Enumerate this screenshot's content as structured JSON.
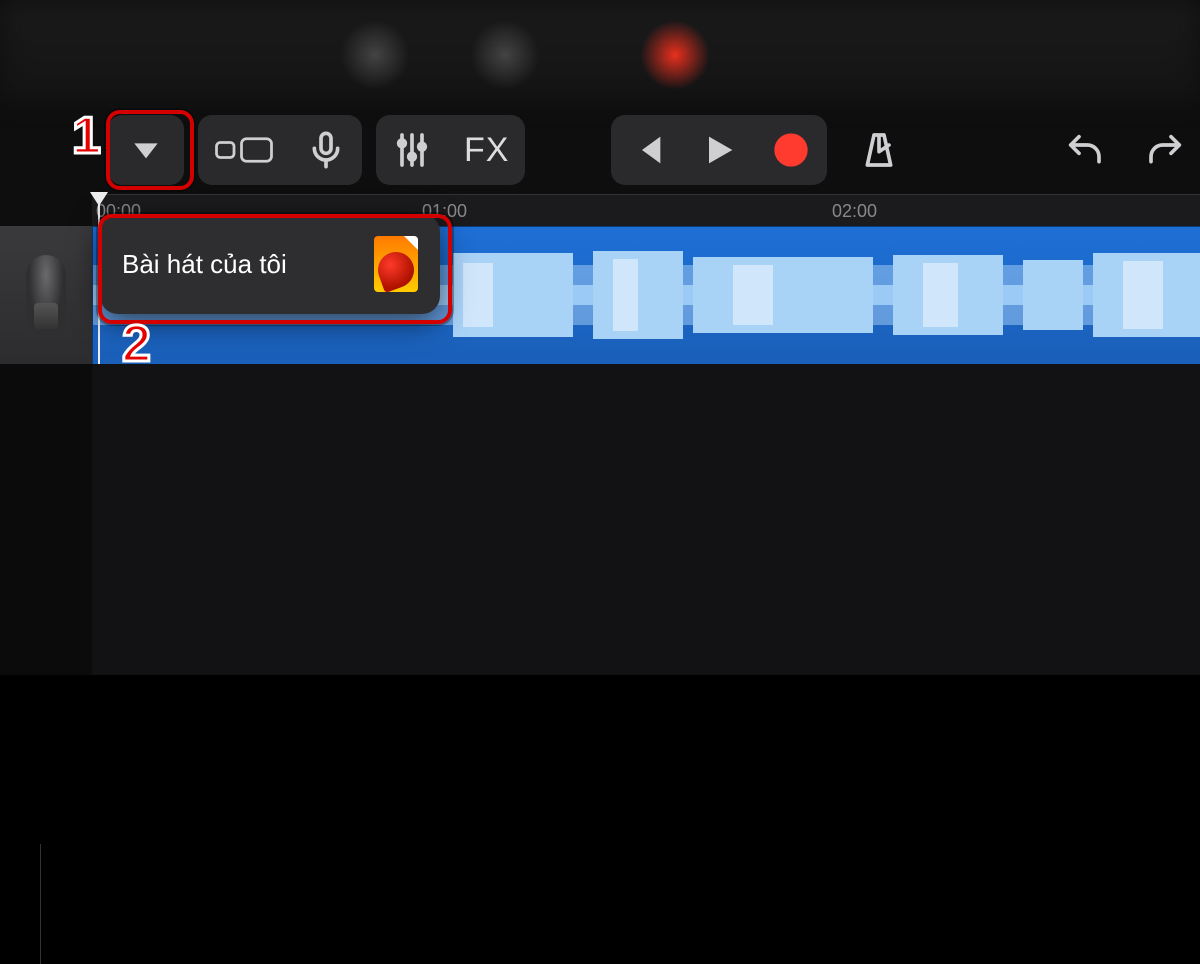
{
  "toolbar": {
    "fx_label": "FX"
  },
  "ruler": {
    "t0": "00:00",
    "t1": "01:00",
    "t2": "02:00"
  },
  "popover": {
    "my_song_label": "Bài hát của tôi"
  },
  "annotations": {
    "step1": "1",
    "step2": "2"
  },
  "colors": {
    "accent_record": "#ff3b30",
    "clip_blue": "#1e6fd6",
    "highlight": "#d40000"
  }
}
